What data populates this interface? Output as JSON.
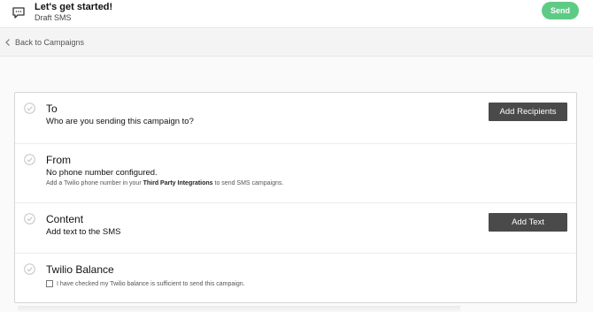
{
  "header": {
    "title": "Let's get started!",
    "subtitle": "Draft SMS",
    "send_label": "Send",
    "send_color": "#5ecb85"
  },
  "nav": {
    "back_label": "Back to Campaigns"
  },
  "steps": [
    {
      "title": "To",
      "description": "Who are you sending this campaign to?",
      "action_label": "Add Recipients"
    },
    {
      "title": "From",
      "description": "No phone number configured.",
      "note_before": "Add a Twilio phone number in your ",
      "note_link": "Third Party Integrations",
      "note_after": " to send SMS campaigns."
    },
    {
      "title": "Content",
      "description": "Add text to the SMS",
      "action_label": "Add Text"
    },
    {
      "title": "Twilio Balance",
      "checkbox_label": "I have checked my Twilio balance is sufficient to send this campaign.",
      "checked": false
    }
  ],
  "icons": {
    "header": "chat-icon",
    "back": "chevron-left-icon",
    "step": "check-circle-icon"
  },
  "colors": {
    "action_button": "#4a4a4a",
    "step_check": "#c4c4c4"
  }
}
